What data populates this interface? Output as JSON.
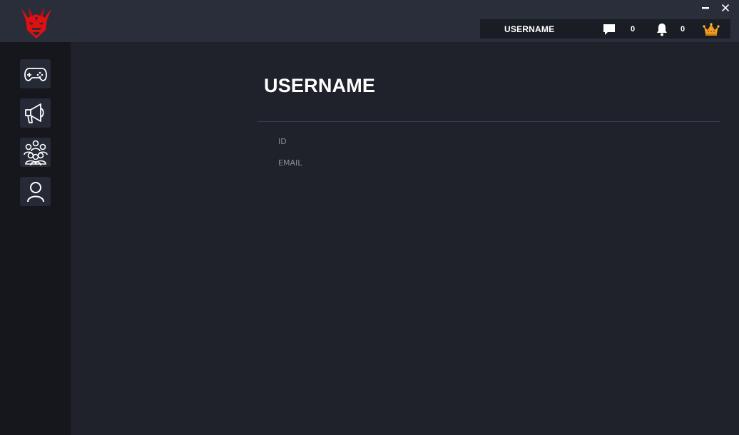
{
  "titlebar": {
    "logo_icon": "red-dragon-logo",
    "minimize_icon": "minimize-icon",
    "close_icon": "close-icon"
  },
  "user_bar": {
    "username": "USERNAME",
    "messages_count": "0",
    "notifications_count": "0",
    "icons": [
      "chat-bubble-icon",
      "bell-icon",
      "crown-icon"
    ]
  },
  "sidebar": {
    "items": [
      {
        "name": "games",
        "icon": "gamepad-icon"
      },
      {
        "name": "announcements",
        "icon": "megaphone-icon"
      },
      {
        "name": "community",
        "icon": "group-icon"
      },
      {
        "name": "profile",
        "icon": "user-icon"
      }
    ]
  },
  "profile": {
    "title": "USERNAME",
    "id_label": "ID",
    "email_label": "EMAIL"
  },
  "colors": {
    "titlebar_bg": "#2a2d3a",
    "sidebar_bg": "#15171c",
    "main_bg": "#20222b",
    "accent_red": "#e01010",
    "crown_gold": "#f0a020"
  }
}
